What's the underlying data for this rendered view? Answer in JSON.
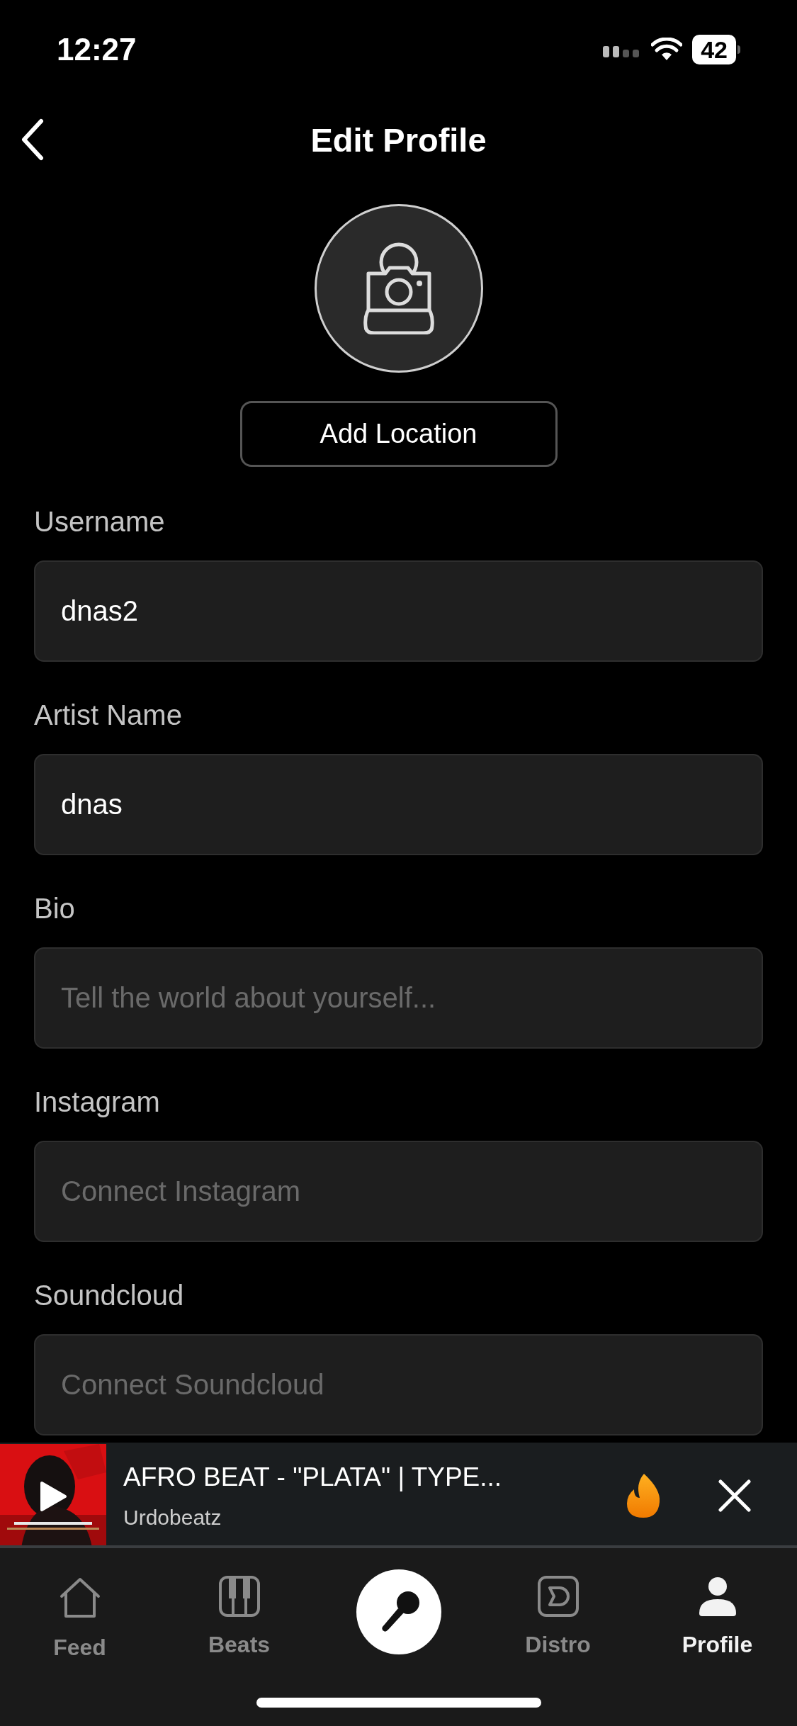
{
  "status_bar": {
    "time": "12:27",
    "battery": "42"
  },
  "header": {
    "title": "Edit Profile"
  },
  "add_location_button": "Add Location",
  "fields": [
    {
      "label": "Username",
      "value": "dnas2"
    },
    {
      "label": "Artist Name",
      "value": "dnas"
    },
    {
      "label": "Bio",
      "placeholder": "Tell the world about yourself..."
    },
    {
      "label": "Instagram",
      "placeholder": "Connect Instagram"
    },
    {
      "label": "Soundcloud",
      "placeholder": "Connect Soundcloud"
    }
  ],
  "mini_player": {
    "title": "AFRO BEAT - \"PLATA\" | TYPE...",
    "artist": "Urdobeatz"
  },
  "tabs": [
    {
      "kind": "feed",
      "label": "Feed",
      "selected": false
    },
    {
      "kind": "beats",
      "label": "Beats",
      "selected": false
    },
    {
      "kind": "record",
      "selected": false
    },
    {
      "kind": "distro",
      "label": "Distro",
      "selected": false
    },
    {
      "kind": "profile",
      "label": "Profile",
      "selected": true
    }
  ]
}
